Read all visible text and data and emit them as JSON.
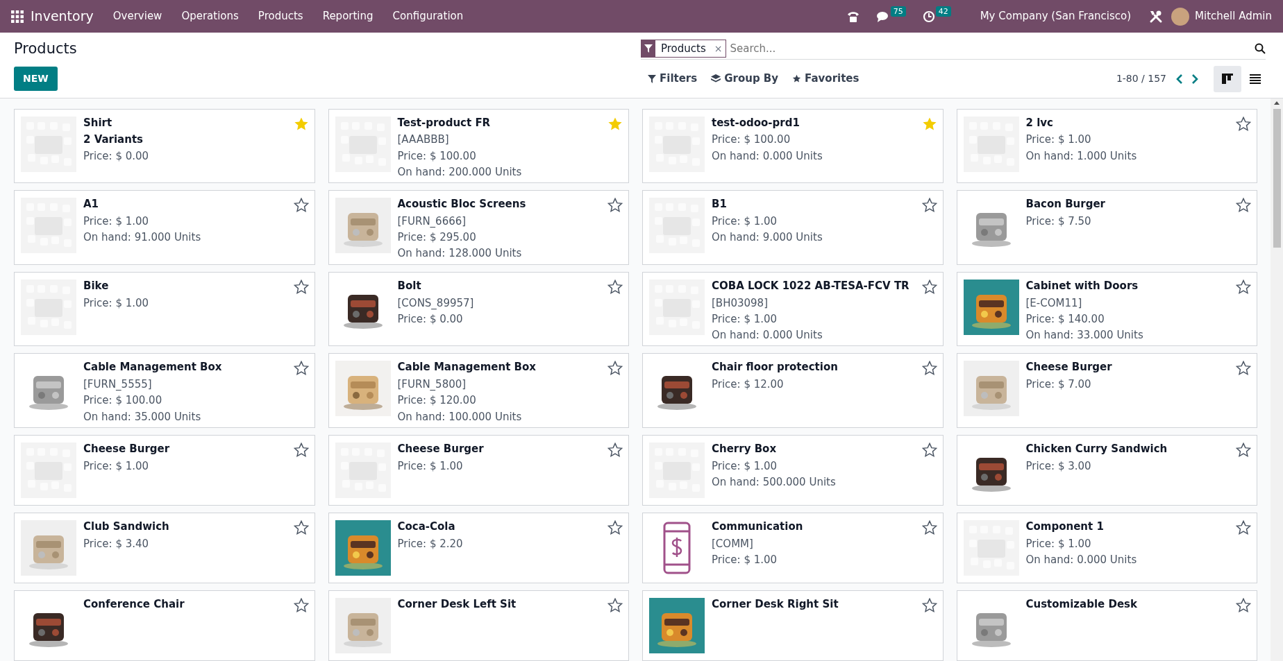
{
  "app_name": "Inventory",
  "menu": [
    {
      "label": "Overview"
    },
    {
      "label": "Operations"
    },
    {
      "label": "Products"
    },
    {
      "label": "Reporting"
    },
    {
      "label": "Configuration"
    }
  ],
  "systray": {
    "messages_count": "75",
    "activities_count": "42",
    "company": "My Company (San Francisco)",
    "user": "Mitchell Admin"
  },
  "page_title": "Products",
  "new_button": "NEW",
  "search": {
    "facet": "Products",
    "facet_remove": "×",
    "placeholder": "Search..."
  },
  "filter_buttons": [
    {
      "kind": "filters",
      "label": "Filters"
    },
    {
      "kind": "group",
      "label": "Group By"
    },
    {
      "kind": "favorites",
      "label": "Favorites"
    }
  ],
  "pager": "1-80 / 157",
  "views": [
    {
      "kind": "kanban",
      "selected": true
    },
    {
      "kind": "list",
      "selected": false
    }
  ],
  "products": [
    {
      "name": "Shirt",
      "favorite": true,
      "kind": "placeholder",
      "lines": [
        {
          "kind": "variants",
          "text": "2 Variants"
        },
        {
          "kind": "price",
          "text": "Price: $ 0.00"
        }
      ]
    },
    {
      "name": "Test-product FR",
      "favorite": true,
      "kind": "placeholder",
      "lines": [
        {
          "kind": "ref",
          "text": "[AAABBB]"
        },
        {
          "kind": "price",
          "text": "Price: $ 100.00"
        },
        {
          "kind": "onhand",
          "text": "On hand: 200.000 Units"
        }
      ]
    },
    {
      "name": "test-odoo-prd1",
      "favorite": true,
      "kind": "placeholder",
      "lines": [
        {
          "kind": "price",
          "text": "Price: $ 100.00"
        },
        {
          "kind": "onhand",
          "text": "On hand: 0.000 Units"
        }
      ]
    },
    {
      "name": "2 lvc",
      "favorite": false,
      "kind": "placeholder",
      "lines": [
        {
          "kind": "price",
          "text": "Price: $ 1.00"
        },
        {
          "kind": "onhand",
          "text": "On hand: 1.000 Units"
        }
      ]
    },
    {
      "name": "A1",
      "favorite": false,
      "kind": "placeholder",
      "lines": [
        {
          "kind": "price",
          "text": "Price: $ 1.00"
        },
        {
          "kind": "onhand",
          "text": "On hand: 91.000 Units"
        }
      ]
    },
    {
      "name": "Acoustic Bloc Screens",
      "favorite": false,
      "kind": "picture",
      "lines": [
        {
          "kind": "ref",
          "text": "[FURN_6666]"
        },
        {
          "kind": "price",
          "text": "Price: $ 295.00"
        },
        {
          "kind": "onhand",
          "text": "On hand: 128.000 Units"
        }
      ]
    },
    {
      "name": "B1",
      "favorite": false,
      "kind": "placeholder",
      "lines": [
        {
          "kind": "price",
          "text": "Price: $ 1.00"
        },
        {
          "kind": "onhand",
          "text": "On hand: 9.000 Units"
        }
      ]
    },
    {
      "name": "Bacon Burger",
      "favorite": false,
      "kind": "picture",
      "lines": [
        {
          "kind": "price",
          "text": "Price: $ 7.50"
        }
      ]
    },
    {
      "name": "Bike",
      "favorite": false,
      "kind": "placeholder",
      "lines": [
        {
          "kind": "price",
          "text": "Price: $ 1.00"
        }
      ]
    },
    {
      "name": "Bolt",
      "favorite": false,
      "kind": "picture",
      "lines": [
        {
          "kind": "ref",
          "text": "[CONS_89957]"
        },
        {
          "kind": "price",
          "text": "Price: $ 0.00"
        }
      ]
    },
    {
      "name": "COBA LOCK 1022 AB-TESA-FCV TR",
      "favorite": false,
      "kind": "placeholder",
      "lines": [
        {
          "kind": "ref",
          "text": "[BH03098]"
        },
        {
          "kind": "price",
          "text": "Price: $ 1.00"
        },
        {
          "kind": "onhand",
          "text": "On hand: 0.000 Units"
        }
      ]
    },
    {
      "name": "Cabinet with Doors",
      "favorite": false,
      "kind": "picture",
      "lines": [
        {
          "kind": "ref",
          "text": "[E-COM11]"
        },
        {
          "kind": "price",
          "text": "Price: $ 140.00"
        },
        {
          "kind": "onhand",
          "text": "On hand: 33.000 Units"
        }
      ]
    },
    {
      "name": "Cable Management Box",
      "favorite": false,
      "kind": "picture",
      "lines": [
        {
          "kind": "ref",
          "text": "[FURN_5555]"
        },
        {
          "kind": "price",
          "text": "Price: $ 100.00"
        },
        {
          "kind": "onhand",
          "text": "On hand: 35.000 Units"
        }
      ]
    },
    {
      "name": "Cable Management Box",
      "favorite": false,
      "kind": "picture",
      "lines": [
        {
          "kind": "ref",
          "text": "[FURN_5800]"
        },
        {
          "kind": "price",
          "text": "Price: $ 120.00"
        },
        {
          "kind": "onhand",
          "text": "On hand: 100.000 Units"
        }
      ]
    },
    {
      "name": "Chair floor protection",
      "favorite": false,
      "kind": "picture",
      "lines": [
        {
          "kind": "price",
          "text": "Price: $ 12.00"
        }
      ]
    },
    {
      "name": "Cheese Burger",
      "favorite": false,
      "kind": "picture",
      "lines": [
        {
          "kind": "price",
          "text": "Price: $ 7.00"
        }
      ]
    },
    {
      "name": "Cheese Burger",
      "favorite": false,
      "kind": "placeholder",
      "lines": [
        {
          "kind": "price",
          "text": "Price: $ 1.00"
        }
      ]
    },
    {
      "name": "Cheese Burger",
      "favorite": false,
      "kind": "placeholder",
      "lines": [
        {
          "kind": "price",
          "text": "Price: $ 1.00"
        }
      ]
    },
    {
      "name": "Cherry Box",
      "favorite": false,
      "kind": "placeholder",
      "lines": [
        {
          "kind": "price",
          "text": "Price: $ 1.00"
        },
        {
          "kind": "onhand",
          "text": "On hand: 500.000 Units"
        }
      ]
    },
    {
      "name": "Chicken Curry Sandwich",
      "favorite": false,
      "kind": "picture",
      "lines": [
        {
          "kind": "price",
          "text": "Price: $ 3.00"
        }
      ]
    },
    {
      "name": "Club Sandwich",
      "favorite": false,
      "kind": "picture",
      "lines": [
        {
          "kind": "price",
          "text": "Price: $ 3.40"
        }
      ]
    },
    {
      "name": "Coca-Cola",
      "favorite": false,
      "kind": "picture",
      "lines": [
        {
          "kind": "price",
          "text": "Price: $ 2.20"
        }
      ]
    },
    {
      "name": "Communication",
      "favorite": false,
      "kind": "icon",
      "lines": [
        {
          "kind": "ref",
          "text": "[COMM]"
        },
        {
          "kind": "price",
          "text": "Price: $ 1.00"
        }
      ]
    },
    {
      "name": "Component 1",
      "favorite": false,
      "kind": "placeholder",
      "lines": [
        {
          "kind": "price",
          "text": "Price: $ 1.00"
        },
        {
          "kind": "onhand",
          "text": "On hand: 0.000 Units"
        }
      ]
    },
    {
      "name": "Conference Chair",
      "favorite": false,
      "kind": "picture"
    },
    {
      "name": "Corner Desk Left Sit",
      "favorite": false,
      "kind": "picture"
    },
    {
      "name": "Corner Desk Right Sit",
      "favorite": false,
      "kind": "picture"
    },
    {
      "name": "Customizable Desk",
      "favorite": false,
      "kind": "picture"
    }
  ]
}
